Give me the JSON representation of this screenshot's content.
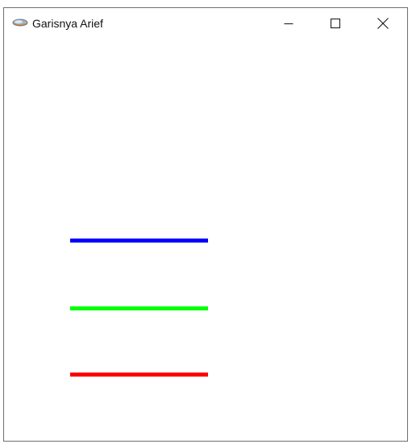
{
  "window": {
    "title": "Garisnya Arief",
    "icon": "java-cup-icon"
  },
  "caption_buttons": [
    {
      "name": "minimize",
      "icon": "minimize-icon"
    },
    {
      "name": "maximize",
      "icon": "maximize-icon"
    },
    {
      "name": "close",
      "icon": "close-icon"
    }
  ],
  "lines": [
    {
      "color": "#0000ff"
    },
    {
      "color": "#00ff00"
    },
    {
      "color": "#ff0000"
    }
  ]
}
